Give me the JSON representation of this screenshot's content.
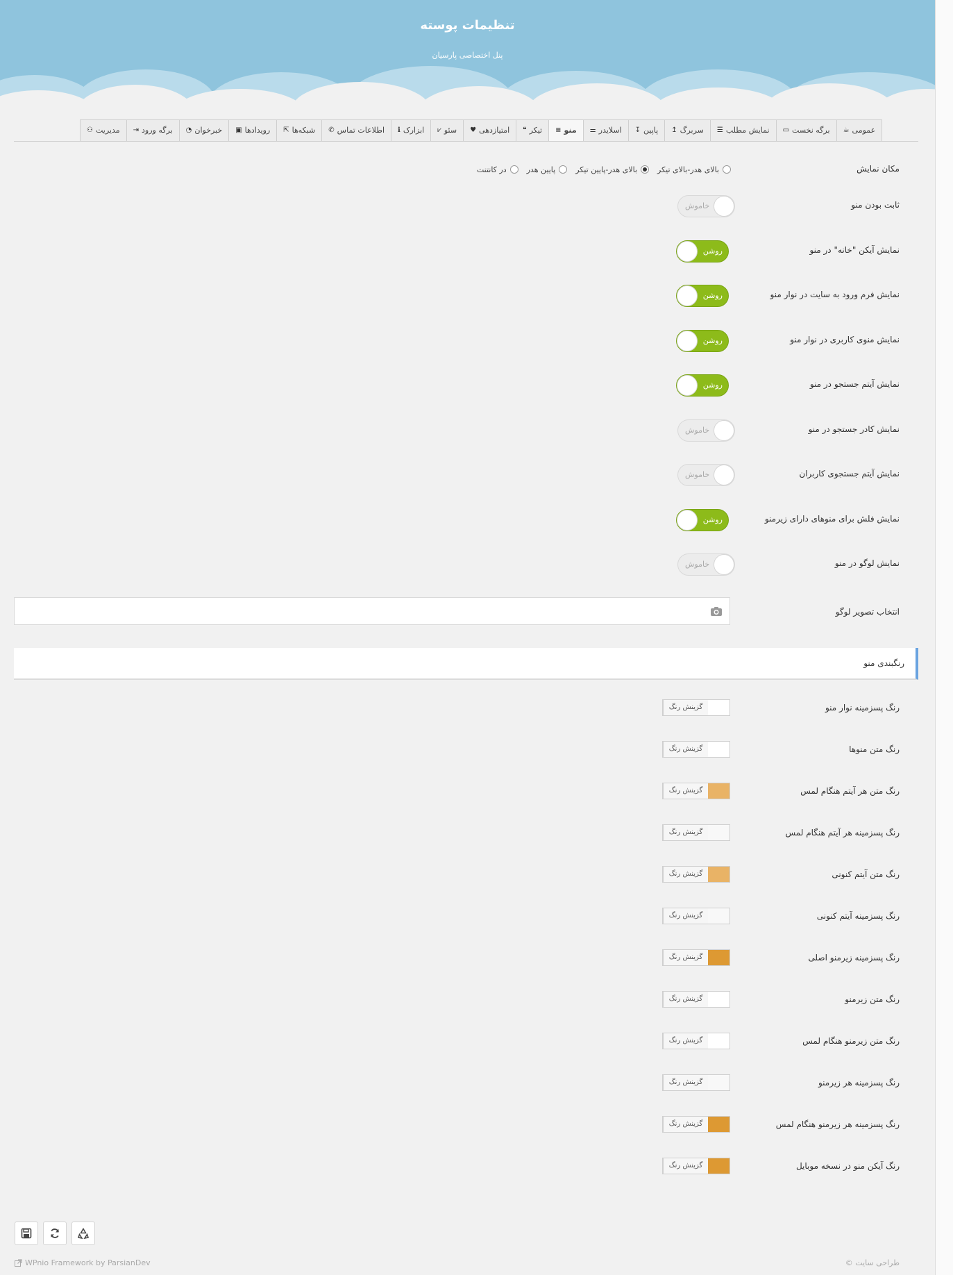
{
  "header": {
    "title": "تنظیمات پوسته",
    "subtitle": "پنل اختصاصی پارسیان"
  },
  "tabs": [
    {
      "label": "عمومی",
      "icon": "coffee-icon",
      "active": false
    },
    {
      "label": "برگه نخست",
      "icon": "desktop-icon",
      "active": false
    },
    {
      "label": "نمایش مطلب",
      "icon": "list-icon",
      "active": false
    },
    {
      "label": "سربرگ",
      "icon": "arrow-up-icon",
      "active": false
    },
    {
      "label": "پاپین",
      "icon": "arrow-down-icon",
      "active": false
    },
    {
      "label": "اسلایدر",
      "icon": "sliders-icon",
      "active": false
    },
    {
      "label": "منو",
      "icon": "bars-icon",
      "active": true
    },
    {
      "label": "تیکر",
      "icon": "quote-icon",
      "active": false
    },
    {
      "label": "امتیازدهی",
      "icon": "heart-icon",
      "active": false
    },
    {
      "label": "سئو",
      "icon": "chart-icon",
      "active": false
    },
    {
      "label": "ابزارک",
      "icon": "info-icon",
      "active": false
    },
    {
      "label": "اطلاعات تماس",
      "icon": "phone-icon",
      "active": false
    },
    {
      "label": "شبکه‌ها",
      "icon": "share-icon",
      "active": false
    },
    {
      "label": "رویدادها",
      "icon": "calendar-icon",
      "active": false
    },
    {
      "label": "خبرخوان",
      "icon": "rss-icon",
      "active": false
    },
    {
      "label": "برگه ورود",
      "icon": "sign-in-icon",
      "active": false
    },
    {
      "label": "مدیریت",
      "icon": "binoculars-icon",
      "active": false
    }
  ],
  "display_location": {
    "label": "مکان نمایش",
    "options": [
      {
        "label": "بالای هدر-بالای تیکر",
        "selected": false
      },
      {
        "label": "بالای هدر-پایین تیکر",
        "selected": true
      },
      {
        "label": "پایین هدر",
        "selected": false
      },
      {
        "label": "در کانتنت",
        "selected": false
      }
    ]
  },
  "toggles": [
    {
      "label": "ثابت بودن منو",
      "state": "خاموش",
      "on": false
    },
    {
      "label": "نمایش آیکن \"خانه\" در منو",
      "state": "روشن",
      "on": true
    },
    {
      "label": "نمایش فرم ورود به سایت در نوار منو",
      "state": "روشن",
      "on": true
    },
    {
      "label": "نمایش منوی کاربری در نوار منو",
      "state": "روشن",
      "on": true
    },
    {
      "label": "نمایش آیتم جستجو در منو",
      "state": "روشن",
      "on": true
    },
    {
      "label": "نمایش کادر جستجو در منو",
      "state": "خاموش",
      "on": false
    },
    {
      "label": "نمایش آیتم جستجوی کاربران",
      "state": "خاموش",
      "on": false
    },
    {
      "label": "نمایش فلش برای منوهای دارای زیرمنو",
      "state": "روشن",
      "on": true
    },
    {
      "label": "نمایش لوگو در منو",
      "state": "خاموش",
      "on": false
    }
  ],
  "logo_select": {
    "label": "انتخاب تصویر لوگو",
    "icon": "camera-icon"
  },
  "section": {
    "title": "رنگبندی منو"
  },
  "color_button_label": "گزینش رنگ",
  "colors": [
    {
      "label": "رنگ پسزمینه نوار منو",
      "value": "#ffffff"
    },
    {
      "label": "رنگ متن منوها",
      "value": "#ffffff"
    },
    {
      "label": "رنگ متن هر آیتم هنگام لمس",
      "value": "#e9b366"
    },
    {
      "label": "رنگ پسزمینه هر آیتم هنگام لمس",
      "value": "#f8f8f8"
    },
    {
      "label": "رنگ متن آیتم کنونی",
      "value": "#e9b366"
    },
    {
      "label": "رنگ پسزمینه آیتم کنونی",
      "value": "#f8f8f8"
    },
    {
      "label": "رنگ پسزمینه زیرمنو اصلی",
      "value": "#dd9933"
    },
    {
      "label": "رنگ متن زیرمنو",
      "value": "#ffffff"
    },
    {
      "label": "رنگ متن زیرمنو هنگام لمس",
      "value": "#ffffff"
    },
    {
      "label": "رنگ پسزمینه هر زیرمنو",
      "value": "#f8f8f8"
    },
    {
      "label": "رنگ پسزمینه هر زیرمنو هنگام لمس",
      "value": "#dd9933"
    },
    {
      "label": "رنگ آیکن منو در نسخه موبایل",
      "value": "#dd9933"
    }
  ],
  "actions": [
    {
      "name": "save",
      "icon": "save-icon"
    },
    {
      "name": "refresh",
      "icon": "refresh-icon"
    },
    {
      "name": "reset",
      "icon": "recycle-icon"
    }
  ],
  "footer": {
    "credit": "WPnio Framework by ParsianDev",
    "design": "© طراحی سایت"
  }
}
